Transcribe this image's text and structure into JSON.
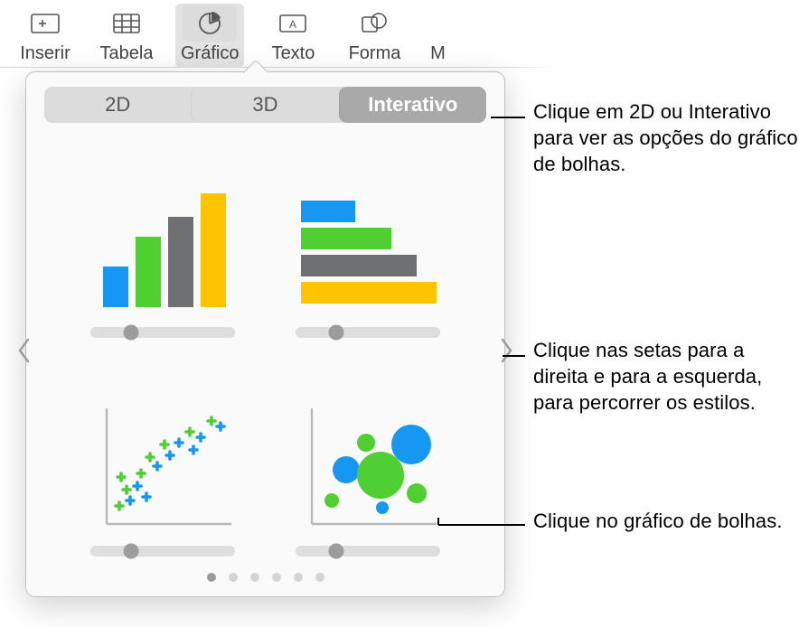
{
  "toolbar": {
    "insert": "Inserir",
    "table": "Tabela",
    "chart": "Gráfico",
    "text": "Texto",
    "shape": "Forma",
    "next_initial": "M"
  },
  "tabs": {
    "d2": "2D",
    "d3": "3D",
    "interactive": "Interativo"
  },
  "callouts": {
    "tabs": "Clique em 2D ou Interativo para ver as opções do gráfico de bolhas.",
    "arrows": "Clique nas setas para a direita e para a esquerda, para percorrer os estilos.",
    "bubble": "Clique no gráfico de bolhas."
  },
  "colors": {
    "blue": "#1698f2",
    "green": "#4fcf31",
    "gray": "#6f7072",
    "yellow": "#ffc400"
  },
  "pager": {
    "count": 6,
    "current": 0
  },
  "slider_pos_pct": 28
}
